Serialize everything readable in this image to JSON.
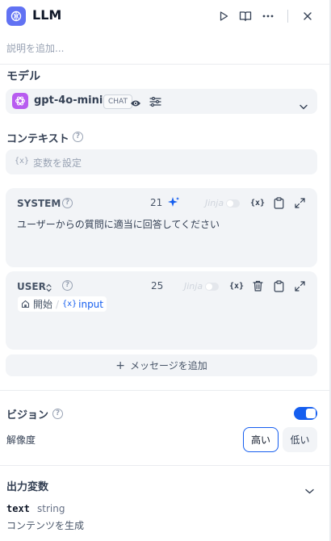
{
  "header": {
    "title": "LLM",
    "description_placeholder": "説明を追加..."
  },
  "model": {
    "section_label": "モデル",
    "name": "gpt-4o-mini",
    "mode_badge": "CHAT"
  },
  "context": {
    "section_label": "コンテキスト",
    "var_icon": "{x}",
    "placeholder": "変数を設定"
  },
  "messages": [
    {
      "role": "SYSTEM",
      "token_count": "21",
      "jinja_label": "Jinja",
      "var_icon": "{x}",
      "text": "ユーザーからの質問に適当に回答してください"
    },
    {
      "role": "USER",
      "token_count": "25",
      "jinja_label": "Jinja",
      "var_icon": "{x}",
      "variable": {
        "node": "開始",
        "separator": "/",
        "var_icon": "{x}",
        "name": "input"
      }
    }
  ],
  "add_message_label": "メッセージを追加",
  "vision": {
    "label": "ビジョン",
    "enabled": true,
    "resolution_label": "解像度",
    "options": [
      "高い",
      "低い"
    ],
    "selected": "高い"
  },
  "output": {
    "section_label": "出力変数",
    "variable_name": "text",
    "variable_type": "string",
    "variable_description": "コンテンツを生成"
  },
  "colors": {
    "accent": "#155eef",
    "app_icon": "#6172f3",
    "model_icon": "#b85cf0"
  }
}
